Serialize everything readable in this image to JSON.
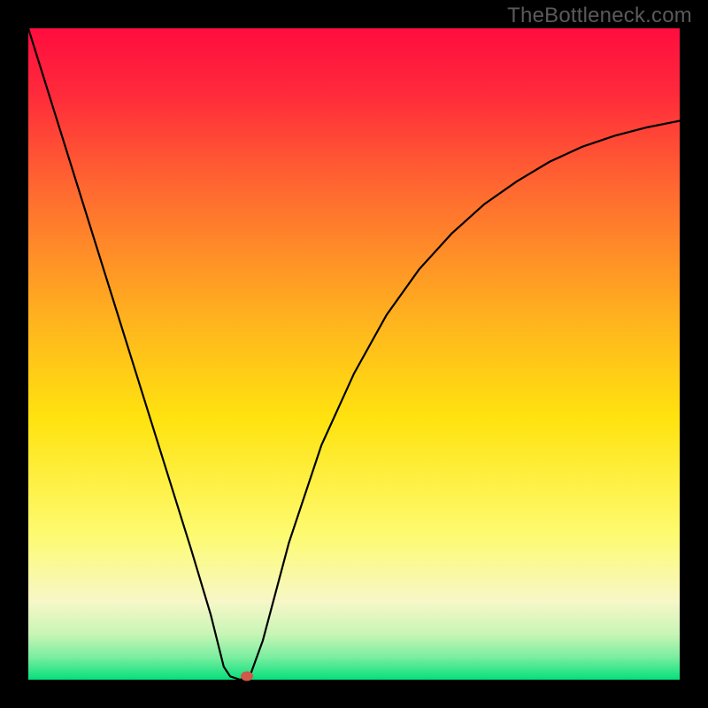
{
  "watermark": "TheBottleneck.com",
  "chart_data": {
    "type": "line",
    "title": "",
    "xlabel": "",
    "ylabel": "",
    "xlim": [
      0,
      1
    ],
    "ylim": [
      0,
      1
    ],
    "background_gradient": {
      "type": "linear-vertical",
      "stops": [
        {
          "pos": 0.0,
          "color": "#ff0d3f"
        },
        {
          "pos": 0.1,
          "color": "#ff2a3b"
        },
        {
          "pos": 0.25,
          "color": "#ff6a30"
        },
        {
          "pos": 0.45,
          "color": "#ffb41e"
        },
        {
          "pos": 0.6,
          "color": "#ffe30f"
        },
        {
          "pos": 0.78,
          "color": "#fdfb72"
        },
        {
          "pos": 0.88,
          "color": "#f7f7c8"
        },
        {
          "pos": 0.93,
          "color": "#c8f5b6"
        },
        {
          "pos": 0.965,
          "color": "#7ceea0"
        },
        {
          "pos": 1.0,
          "color": "#05e07c"
        }
      ]
    },
    "series": [
      {
        "name": "curve",
        "color": "#000000",
        "points": [
          {
            "x": 0.0,
            "y": 1.0
          },
          {
            "x": 0.05,
            "y": 0.84
          },
          {
            "x": 0.1,
            "y": 0.68
          },
          {
            "x": 0.15,
            "y": 0.52
          },
          {
            "x": 0.2,
            "y": 0.36
          },
          {
            "x": 0.25,
            "y": 0.2
          },
          {
            "x": 0.28,
            "y": 0.1
          },
          {
            "x": 0.3,
            "y": 0.02
          },
          {
            "x": 0.31,
            "y": 0.005
          },
          {
            "x": 0.325,
            "y": 0.0
          },
          {
            "x": 0.34,
            "y": 0.005
          },
          {
            "x": 0.36,
            "y": 0.06
          },
          {
            "x": 0.4,
            "y": 0.21
          },
          {
            "x": 0.45,
            "y": 0.36
          },
          {
            "x": 0.5,
            "y": 0.47
          },
          {
            "x": 0.55,
            "y": 0.56
          },
          {
            "x": 0.6,
            "y": 0.63
          },
          {
            "x": 0.65,
            "y": 0.685
          },
          {
            "x": 0.7,
            "y": 0.73
          },
          {
            "x": 0.75,
            "y": 0.765
          },
          {
            "x": 0.8,
            "y": 0.795
          },
          {
            "x": 0.85,
            "y": 0.818
          },
          {
            "x": 0.9,
            "y": 0.835
          },
          {
            "x": 0.95,
            "y": 0.848
          },
          {
            "x": 1.0,
            "y": 0.858
          }
        ]
      }
    ],
    "marker": {
      "x": 0.335,
      "y": 0.005,
      "color": "#cf594b"
    }
  }
}
